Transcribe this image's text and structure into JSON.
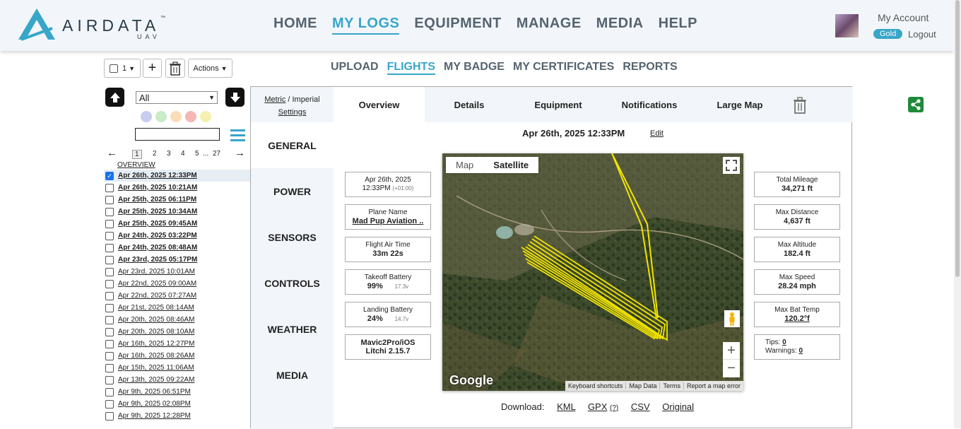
{
  "brand": {
    "name": "AIRDATA",
    "sub": "UAV",
    "tm": "™"
  },
  "main_nav": [
    {
      "label": "HOME",
      "active": false
    },
    {
      "label": "MY LOGS",
      "active": true
    },
    {
      "label": "EQUIPMENT",
      "active": false
    },
    {
      "label": "MANAGE",
      "active": false
    },
    {
      "label": "MEDIA",
      "active": false
    },
    {
      "label": "HELP",
      "active": false
    }
  ],
  "account": {
    "label": "My Account",
    "badge": "Gold",
    "logout": "Logout"
  },
  "toolbar": {
    "select_count": "1",
    "actions": "Actions"
  },
  "sub_nav": [
    {
      "label": "UPLOAD",
      "active": false
    },
    {
      "label": "FLIGHTS",
      "active": true
    },
    {
      "label": "MY BADGE",
      "active": false
    },
    {
      "label": "MY CERTIFICATES",
      "active": false
    },
    {
      "label": "REPORTS",
      "active": false
    }
  ],
  "sidebar": {
    "filter_value": "All",
    "color_dots": [
      "#c6cdf0",
      "#c7ecc7",
      "#f9dcb8",
      "#f4b7b4",
      "#f6f0b0"
    ],
    "pager": {
      "current": "1",
      "pages": [
        "2",
        "3",
        "4",
        "5"
      ],
      "ellipsis": "...",
      "last": "27"
    },
    "overview_link": "OVERVIEW",
    "flights": [
      {
        "label": "Apr 26th, 2025 12:33PM",
        "checked": true,
        "bold": true
      },
      {
        "label": "Apr 26th, 2025 10:21AM",
        "checked": false,
        "bold": true
      },
      {
        "label": "Apr 25th, 2025 06:11PM",
        "checked": false,
        "bold": true
      },
      {
        "label": "Apr 25th, 2025 10:34AM",
        "checked": false,
        "bold": true
      },
      {
        "label": "Apr 25th, 2025 09:45AM",
        "checked": false,
        "bold": true
      },
      {
        "label": "Apr 24th, 2025 03:22PM",
        "checked": false,
        "bold": true
      },
      {
        "label": "Apr 24th, 2025 08:48AM",
        "checked": false,
        "bold": true
      },
      {
        "label": "Apr 23rd, 2025 05:17PM",
        "checked": false,
        "bold": true
      },
      {
        "label": "Apr 23rd, 2025 10:01AM",
        "checked": false,
        "bold": false
      },
      {
        "label": "Apr 22nd, 2025 09:00AM",
        "checked": false,
        "bold": false
      },
      {
        "label": "Apr 22nd, 2025 07:27AM",
        "checked": false,
        "bold": false
      },
      {
        "label": "Apr 21st, 2025 08:14AM",
        "checked": false,
        "bold": false
      },
      {
        "label": "Apr 20th, 2025 08:46AM",
        "checked": false,
        "bold": false
      },
      {
        "label": "Apr 20th, 2025 08:10AM",
        "checked": false,
        "bold": false
      },
      {
        "label": "Apr 16th, 2025 12:27PM",
        "checked": false,
        "bold": false
      },
      {
        "label": "Apr 16th, 2025 08:26AM",
        "checked": false,
        "bold": false
      },
      {
        "label": "Apr 15th, 2025 11:06AM",
        "checked": false,
        "bold": false
      },
      {
        "label": "Apr 13th, 2025 09:22AM",
        "checked": false,
        "bold": false
      },
      {
        "label": "Apr 9th, 2025 06:51PM",
        "checked": false,
        "bold": false
      },
      {
        "label": "Apr 9th, 2025 02:08PM",
        "checked": false,
        "bold": false
      },
      {
        "label": "Apr 9th, 2025 12:28PM",
        "checked": false,
        "bold": false
      }
    ]
  },
  "panel": {
    "units": {
      "metric": "Metric",
      "sep": " / ",
      "imperial": "Imperial",
      "settings": "Settings"
    },
    "sections": [
      "GENERAL",
      "POWER",
      "SENSORS",
      "CONTROLS",
      "WEATHER",
      "MEDIA"
    ],
    "tabs": [
      "Overview",
      "Details",
      "Equipment",
      "Notifications",
      "Large Map"
    ],
    "title": "Apr 26th, 2025 12:33PM",
    "edit": "Edit",
    "left_cards": [
      {
        "label": "Apr 26th, 2025",
        "value": "12:33PM",
        "extra": "(+01:00)"
      },
      {
        "label": "Plane Name",
        "value": "Mad Pup Aviation ..",
        "extra": ""
      },
      {
        "label": "Flight Air Time",
        "value": "33m 22s",
        "extra": ""
      },
      {
        "label": "Takeoff Battery",
        "value": "99%",
        "extra": "17.3v"
      },
      {
        "label": "Landing Battery",
        "value": "24%",
        "extra": "14.7v"
      },
      {
        "label": "Mavic2Pro/iOS",
        "value": "Litchi 2.15.7",
        "extra": ""
      }
    ],
    "right_cards": [
      {
        "label": "Total Mileage",
        "value": "34,271 ft"
      },
      {
        "label": "Max Distance",
        "value": "4,637 ft"
      },
      {
        "label": "Max Altitude",
        "value": "182.4 ft"
      },
      {
        "label": "Max Speed",
        "value": "28.24 mph"
      },
      {
        "label": "Max Bat Temp",
        "value": "120.2°f"
      }
    ],
    "tips": {
      "tips_label": "Tips:",
      "tips_value": "0",
      "warn_label": "Warnings:",
      "warn_value": "0"
    },
    "map": {
      "toggle": [
        "Map",
        "Satellite"
      ],
      "google": "Google",
      "attribution": [
        "Keyboard shortcuts",
        "Map Data",
        "Terms",
        "Report a map error"
      ]
    },
    "download": {
      "label": "Download:",
      "links": [
        "KML",
        "GPX",
        "CSV",
        "Original"
      ],
      "gpx_help": "(?)"
    }
  }
}
